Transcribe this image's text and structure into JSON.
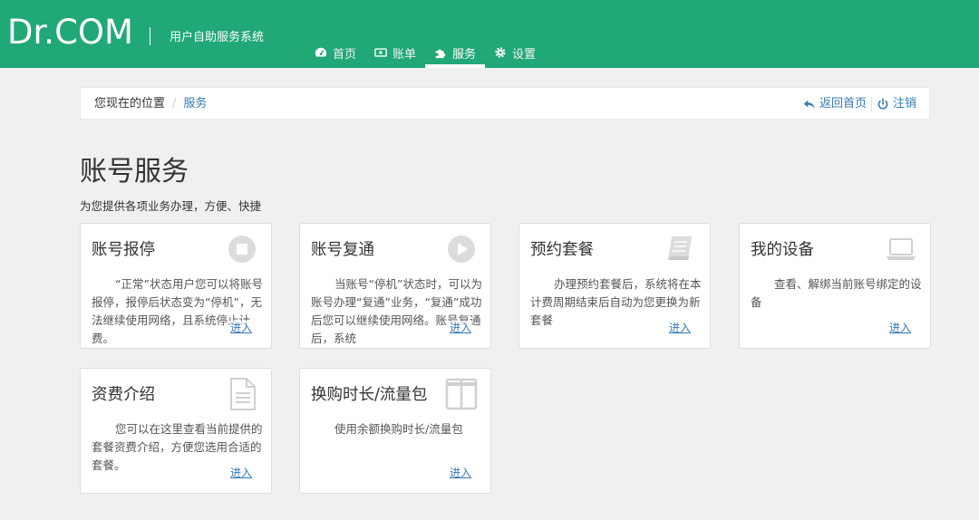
{
  "header": {
    "logo": "Dr.COM",
    "subtitle": "用户自助服务系统",
    "nav": [
      {
        "label": "首页",
        "icon": "dashboard-icon"
      },
      {
        "label": "账单",
        "icon": "money-icon"
      },
      {
        "label": "服务",
        "icon": "puzzle-icon",
        "active": true
      },
      {
        "label": "设置",
        "icon": "gear-icon"
      }
    ],
    "colors": {
      "brand": "#20a877"
    }
  },
  "breadcrumb": {
    "prefix": "您现在的位置",
    "separator": "/",
    "current": "服务",
    "home_link": "返回首页",
    "logout_link": "注销"
  },
  "page": {
    "title": "账号服务",
    "subtitle": "为您提供各项业务办理，方便、快捷"
  },
  "cards": [
    {
      "title": "账号报停",
      "icon": "stop-icon",
      "desc": "“正常”状态用户您可以将账号报停，报停后状态变为“停机”，无法继续使用网络，且系统停止计费。",
      "link": "进入"
    },
    {
      "title": "账号复通",
      "icon": "play-icon",
      "desc": "当账号“停机”状态时，可以为账号办理“复通”业务，“复通”成功后您可以继续使用网络。账号复通后，系统",
      "link": "进入"
    },
    {
      "title": "预约套餐",
      "icon": "book-icon",
      "desc": "办理预约套餐后，系统将在本计费周期结束后自动为您更换为新套餐",
      "link": "进入"
    },
    {
      "title": "我的设备",
      "icon": "laptop-icon",
      "desc": "查看、解绑当前账号绑定的设备",
      "link": "进入"
    },
    {
      "title": "资费介绍",
      "icon": "document-icon",
      "desc": "您可以在这里查看当前提供的套餐资费介绍，方便您选用合适的套餐。",
      "link": "进入"
    },
    {
      "title": "换购时长/流量包",
      "icon": "columns-icon",
      "desc": "使用余额换购时长/流量包",
      "link": "进入"
    }
  ]
}
